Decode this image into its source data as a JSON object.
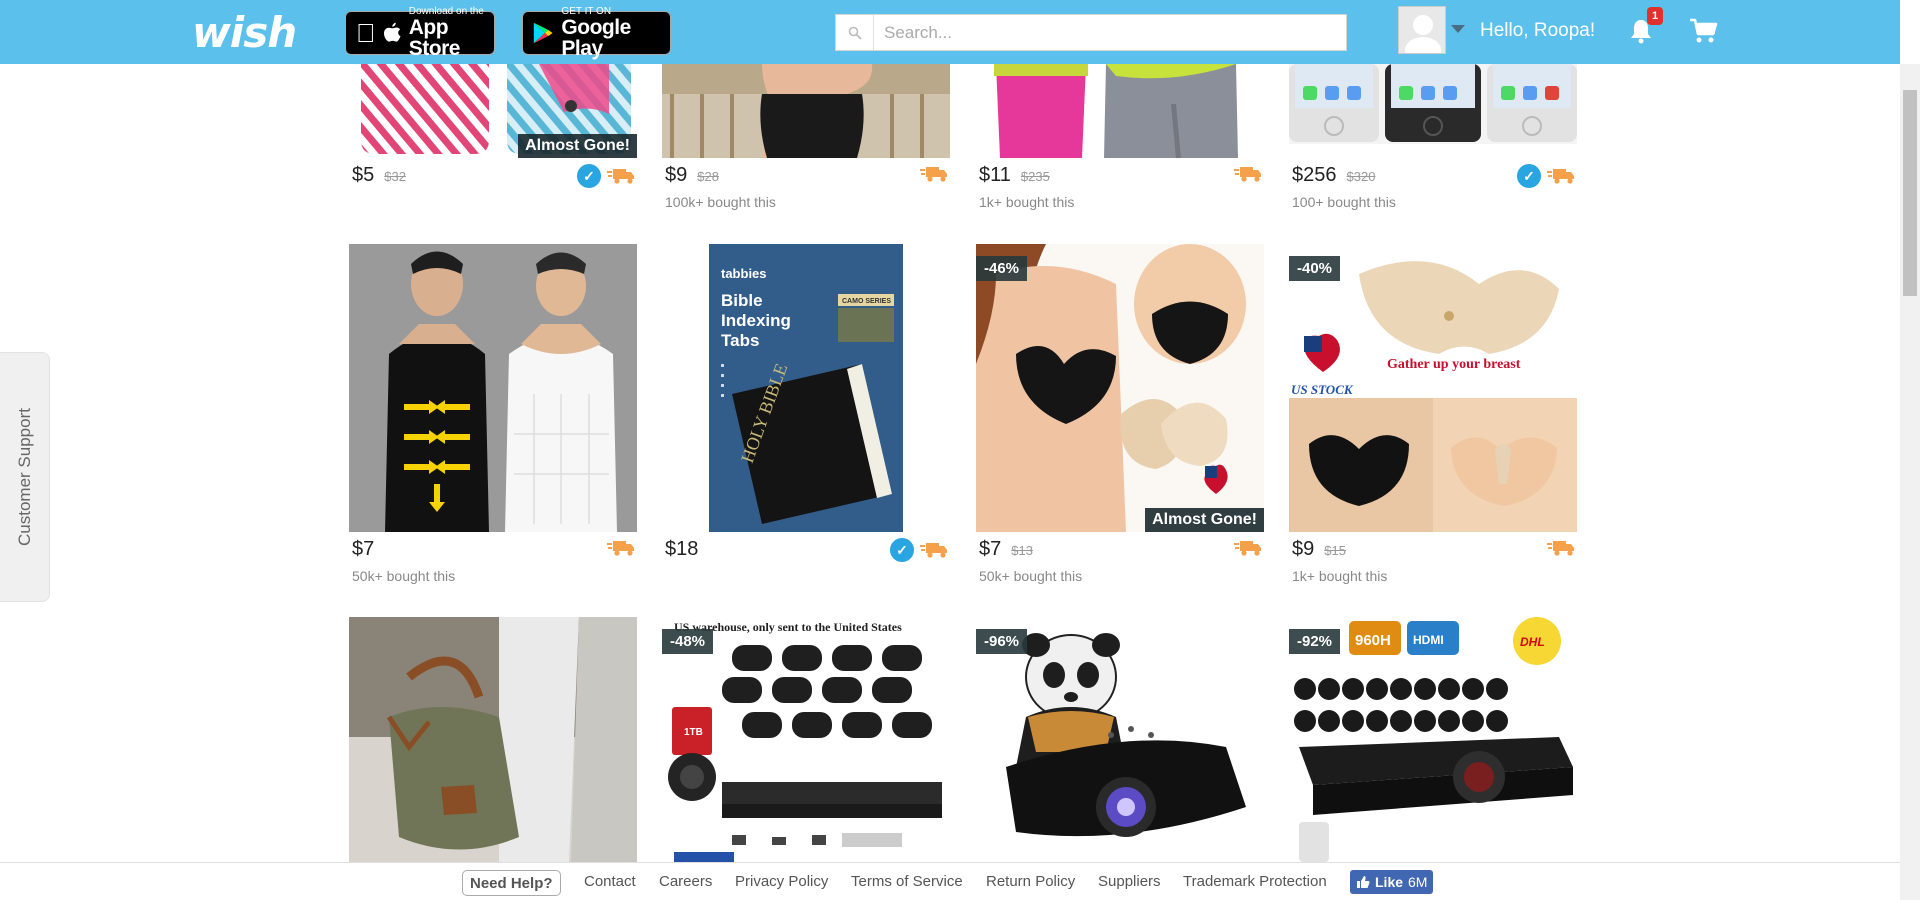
{
  "header": {
    "logo": "wish",
    "appstore_small": "Download on the",
    "appstore_big": "App Store",
    "googleplay_small": "GET IT ON",
    "googleplay_big": "Google Play",
    "search_placeholder": "Search...",
    "greeting": "Hello, Roopa!",
    "notification_count": "1"
  },
  "support_tab": "Customer Support",
  "products": [
    {
      "price": "$5",
      "old_price": "$32",
      "bought": "",
      "discount": "",
      "almost_gone": "Almost Gone!",
      "verified": true
    },
    {
      "price": "$9",
      "old_price": "$28",
      "bought": "100k+ bought this",
      "discount": "",
      "almost_gone": "",
      "verified": false
    },
    {
      "price": "$11",
      "old_price": "$235",
      "bought": "1k+ bought this",
      "discount": "",
      "almost_gone": "",
      "verified": false
    },
    {
      "price": "$256",
      "old_price": "$320",
      "bought": "100+ bought this",
      "discount": "",
      "almost_gone": "",
      "verified": true
    },
    {
      "price": "$7",
      "old_price": "",
      "bought": "50k+ bought this",
      "discount": "",
      "almost_gone": "",
      "verified": false
    },
    {
      "price": "$18",
      "old_price": "",
      "bought": "",
      "discount": "",
      "almost_gone": "",
      "verified": true
    },
    {
      "price": "$7",
      "old_price": "$13",
      "bought": "50k+ bought this",
      "discount": "-46%",
      "almost_gone": "Almost Gone!",
      "verified": false
    },
    {
      "price": "$9",
      "old_price": "$15",
      "bought": "1k+ bought this",
      "discount": "-40%",
      "almost_gone": "",
      "verified": false
    },
    {
      "price": "",
      "old_price": "",
      "bought": "",
      "discount": "",
      "almost_gone": "",
      "verified": false
    },
    {
      "price": "",
      "old_price": "",
      "bought": "",
      "discount": "-48%",
      "almost_gone": "",
      "verified": false
    },
    {
      "price": "",
      "old_price": "",
      "bought": "",
      "discount": "-96%",
      "almost_gone": "",
      "verified": false
    },
    {
      "price": "",
      "old_price": "",
      "bought": "",
      "discount": "-92%",
      "almost_gone": "",
      "verified": false
    }
  ],
  "image_text": {
    "bible_brand": "tabbies",
    "bible_title_1": "Bible",
    "bible_title_2": "Indexing",
    "bible_title_3": "Tabs",
    "bible_series": "CAMO SERIES",
    "bra_caption": "Gather up your breast",
    "bra_stock": "US STOCK",
    "cam_caption": "US warehouse, only sent to the United States",
    "hdd_label": "1TB",
    "dvr_960": "960H",
    "dvr_hdmi": "HDMI",
    "dhl": "DHL"
  },
  "footer": {
    "need_help": "Need Help?",
    "links": [
      "Contact",
      "Careers",
      "Privacy Policy",
      "Terms of Service",
      "Return Policy",
      "Suppliers",
      "Trademark Protection"
    ],
    "like": "Like",
    "like_count": "6M"
  },
  "colors": {
    "header_bg": "#5bc0eb",
    "verified": "#29a5e2",
    "truck": "#f5a04a",
    "badge_red": "#e0322b",
    "facebook": "#4267b2"
  }
}
